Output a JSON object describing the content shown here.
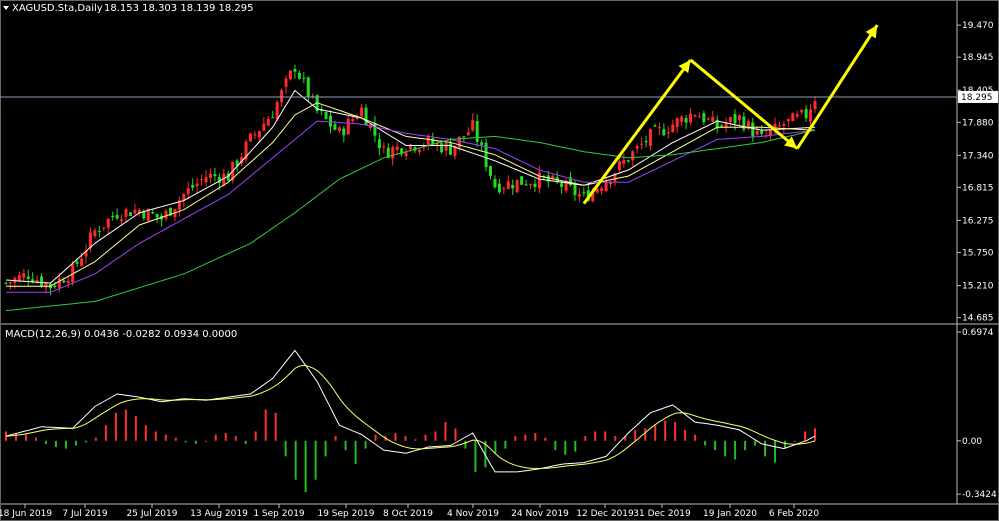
{
  "chart_data": [
    {
      "type": "candlestick",
      "symbol_label": "XAGUSD.Sta,Daily",
      "ohlc_label": "18.153 18.303 18.139 18.295",
      "current_price_label": "18.295",
      "y_ticks": [
        19.47,
        18.945,
        18.405,
        17.88,
        17.34,
        16.815,
        16.275,
        15.75,
        15.21,
        14.685
      ],
      "x_tick_labels": [
        "18 Jun 2019",
        "7 Jul 2019",
        "25 Jul 2019",
        "13 Aug 2019",
        "1 Sep 2019",
        "19 Sep 2019",
        "8 Oct 2019",
        "4 Nov 2019",
        "24 Nov 2019",
        "12 Dec 2019",
        "31 Dec 2019",
        "19 Jan 2020",
        "6 Feb 2020"
      ],
      "ylim": [
        14.63,
        19.75
      ],
      "close_path": [
        [
          0,
          15.25
        ],
        [
          5,
          15.4
        ],
        [
          10,
          15.2
        ],
        [
          15,
          15.45
        ],
        [
          20,
          16.1
        ],
        [
          25,
          16.4
        ],
        [
          30,
          16.45
        ],
        [
          35,
          16.3
        ],
        [
          40,
          16.7
        ],
        [
          45,
          17.0
        ],
        [
          50,
          17.0
        ],
        [
          55,
          17.6
        ],
        [
          60,
          18.05
        ],
        [
          65,
          18.8
        ],
        [
          70,
          18.05
        ],
        [
          75,
          17.7
        ],
        [
          80,
          18.1
        ],
        [
          85,
          17.4
        ],
        [
          90,
          17.5
        ],
        [
          95,
          17.55
        ],
        [
          100,
          17.45
        ],
        [
          105,
          17.8
        ],
        [
          110,
          16.85
        ],
        [
          115,
          16.9
        ],
        [
          120,
          16.95
        ],
        [
          125,
          16.85
        ],
        [
          130,
          16.65
        ],
        [
          135,
          16.95
        ],
        [
          140,
          17.3
        ],
        [
          145,
          17.65
        ],
        [
          150,
          17.85
        ],
        [
          155,
          18.05
        ],
        [
          160,
          17.8
        ],
        [
          165,
          17.95
        ],
        [
          170,
          17.6
        ],
        [
          175,
          17.85
        ],
        [
          180,
          18.0
        ],
        [
          182,
          18.295
        ]
      ],
      "ma_lines": [
        {
          "color": "#ffffff",
          "values": [
            [
              0,
              15.3
            ],
            [
              10,
              15.25
            ],
            [
              20,
              15.9
            ],
            [
              30,
              16.4
            ],
            [
              40,
              16.6
            ],
            [
              50,
              17.0
            ],
            [
              60,
              17.8
            ],
            [
              65,
              18.4
            ],
            [
              70,
              18.1
            ],
            [
              80,
              17.95
            ],
            [
              90,
              17.5
            ],
            [
              100,
              17.5
            ],
            [
              110,
              17.25
            ],
            [
              120,
              16.95
            ],
            [
              130,
              16.85
            ],
            [
              140,
              17.1
            ],
            [
              150,
              17.55
            ],
            [
              160,
              17.9
            ],
            [
              170,
              17.75
            ],
            [
              182,
              17.8
            ]
          ]
        },
        {
          "color": "#ffff99",
          "values": [
            [
              0,
              15.2
            ],
            [
              10,
              15.2
            ],
            [
              20,
              15.6
            ],
            [
              30,
              16.2
            ],
            [
              40,
              16.45
            ],
            [
              50,
              16.9
            ],
            [
              60,
              17.55
            ],
            [
              65,
              18.0
            ],
            [
              70,
              18.2
            ],
            [
              80,
              17.95
            ],
            [
              90,
              17.65
            ],
            [
              100,
              17.55
            ],
            [
              110,
              17.35
            ],
            [
              120,
              17.0
            ],
            [
              130,
              16.85
            ],
            [
              140,
              17.0
            ],
            [
              150,
              17.4
            ],
            [
              160,
              17.8
            ],
            [
              170,
              17.8
            ],
            [
              182,
              17.75
            ]
          ]
        },
        {
          "color": "#a040ff",
          "values": [
            [
              0,
              15.1
            ],
            [
              10,
              15.1
            ],
            [
              20,
              15.4
            ],
            [
              30,
              15.9
            ],
            [
              40,
              16.3
            ],
            [
              50,
              16.7
            ],
            [
              60,
              17.3
            ],
            [
              65,
              17.6
            ],
            [
              70,
              17.9
            ],
            [
              80,
              17.85
            ],
            [
              90,
              17.7
            ],
            [
              100,
              17.6
            ],
            [
              110,
              17.45
            ],
            [
              120,
              17.1
            ],
            [
              130,
              16.9
            ],
            [
              140,
              16.9
            ],
            [
              150,
              17.25
            ],
            [
              160,
              17.6
            ],
            [
              170,
              17.65
            ],
            [
              182,
              17.75
            ]
          ]
        },
        {
          "color": "#2ecc40",
          "values": [
            [
              0,
              14.8
            ],
            [
              20,
              14.95
            ],
            [
              40,
              15.4
            ],
            [
              55,
              15.9
            ],
            [
              65,
              16.4
            ],
            [
              75,
              16.95
            ],
            [
              85,
              17.3
            ],
            [
              100,
              17.6
            ],
            [
              110,
              17.65
            ],
            [
              120,
              17.55
            ],
            [
              130,
              17.4
            ],
            [
              140,
              17.3
            ],
            [
              150,
              17.35
            ],
            [
              160,
              17.45
            ],
            [
              170,
              17.55
            ],
            [
              182,
              17.75
            ]
          ]
        }
      ],
      "annotation_arrows": [
        {
          "color": "#ffff00",
          "from": [
            130,
            16.55
          ],
          "to": [
            154,
            18.9
          ]
        },
        {
          "color": "#ffff00",
          "from": [
            154,
            18.9
          ],
          "to": [
            178,
            17.45
          ]
        },
        {
          "color": "#ffff00",
          "from": [
            178,
            17.45
          ],
          "to": [
            196,
            19.47
          ]
        }
      ]
    },
    {
      "type": "macd",
      "label": "MACD(12,26,9) 0.0436 -0.0282 0.0934 0.0000",
      "y_ticks": [
        0.6974,
        0.0,
        -0.3424
      ],
      "ylim": [
        -0.38,
        0.73
      ],
      "histogram": [
        0.06,
        0.05,
        0.04,
        0.02,
        -0.02,
        -0.04,
        -0.05,
        -0.03,
        -0.01,
        0.02,
        0.1,
        0.18,
        0.2,
        0.16,
        0.1,
        0.06,
        0.04,
        0.02,
        -0.01,
        -0.02,
        0.0,
        0.04,
        0.05,
        0.03,
        -0.02,
        0.06,
        0.2,
        0.18,
        -0.1,
        -0.25,
        -0.33,
        -0.25,
        -0.1,
        0.03,
        -0.06,
        -0.15,
        -0.05,
        0.04,
        0.03,
        0.05,
        0.03,
        0.01,
        0.04,
        0.06,
        0.12,
        0.08,
        -0.05,
        -0.2,
        -0.17,
        -0.08,
        -0.05,
        0.03,
        0.04,
        0.05,
        0.02,
        -0.06,
        -0.09,
        -0.07,
        0.03,
        0.06,
        0.06,
        0.03,
        0.03,
        0.07,
        0.08,
        0.1,
        0.13,
        0.12,
        0.07,
        0.04,
        -0.03,
        -0.06,
        -0.1,
        -0.12,
        -0.06,
        -0.03,
        -0.1,
        -0.14,
        -0.05,
        0.0,
        0.06,
        0.08
      ],
      "macd_line": [
        [
          0,
          0.03
        ],
        [
          8,
          0.09
        ],
        [
          15,
          0.08
        ],
        [
          20,
          0.22
        ],
        [
          25,
          0.3
        ],
        [
          30,
          0.28
        ],
        [
          35,
          0.25
        ],
        [
          40,
          0.27
        ],
        [
          45,
          0.26
        ],
        [
          55,
          0.3
        ],
        [
          60,
          0.4
        ],
        [
          65,
          0.58
        ],
        [
          70,
          0.38
        ],
        [
          75,
          0.1
        ],
        [
          80,
          0.04
        ],
        [
          85,
          -0.06
        ],
        [
          90,
          -0.08
        ],
        [
          95,
          -0.04
        ],
        [
          100,
          -0.03
        ],
        [
          105,
          0.05
        ],
        [
          110,
          -0.2
        ],
        [
          115,
          -0.2
        ],
        [
          120,
          -0.18
        ],
        [
          125,
          -0.15
        ],
        [
          130,
          -0.14
        ],
        [
          135,
          -0.1
        ],
        [
          140,
          0.05
        ],
        [
          145,
          0.18
        ],
        [
          150,
          0.23
        ],
        [
          155,
          0.12
        ],
        [
          160,
          0.1
        ],
        [
          165,
          0.07
        ],
        [
          170,
          -0.02
        ],
        [
          175,
          -0.05
        ],
        [
          180,
          0.0
        ],
        [
          182,
          0.03
        ]
      ]
    }
  ]
}
